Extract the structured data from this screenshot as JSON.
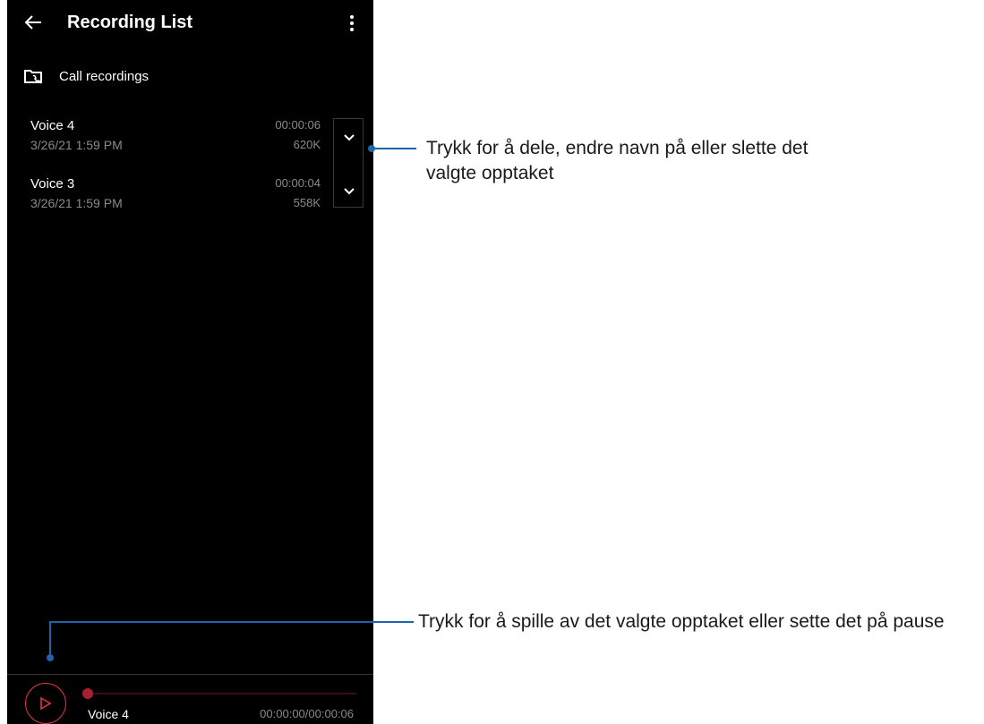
{
  "header": {
    "title": "Recording List",
    "back_icon": "arrow-left-icon",
    "menu_icon": "more-vertical-icon"
  },
  "folder": {
    "label": "Call recordings",
    "icon": "call-folder-icon"
  },
  "recordings": [
    {
      "name": "Voice 4",
      "date": "3/26/21 1:59 PM",
      "duration": "00:00:06",
      "size": "620K"
    },
    {
      "name": "Voice 3",
      "date": "3/26/21 1:59 PM",
      "duration": "00:00:04",
      "size": "558K"
    }
  ],
  "player": {
    "track_name": "Voice 4",
    "time": "00:00:00/00:00:06",
    "progress": 0,
    "accent": "#e0334c"
  },
  "callouts": {
    "expand_line1": "Trykk for å dele, endre navn på eller slette det",
    "expand_line2": "valgte opptaket",
    "play": "Trykk for å spille av det valgte opptaket eller sette det på pause",
    "color": "#1f63a8"
  }
}
